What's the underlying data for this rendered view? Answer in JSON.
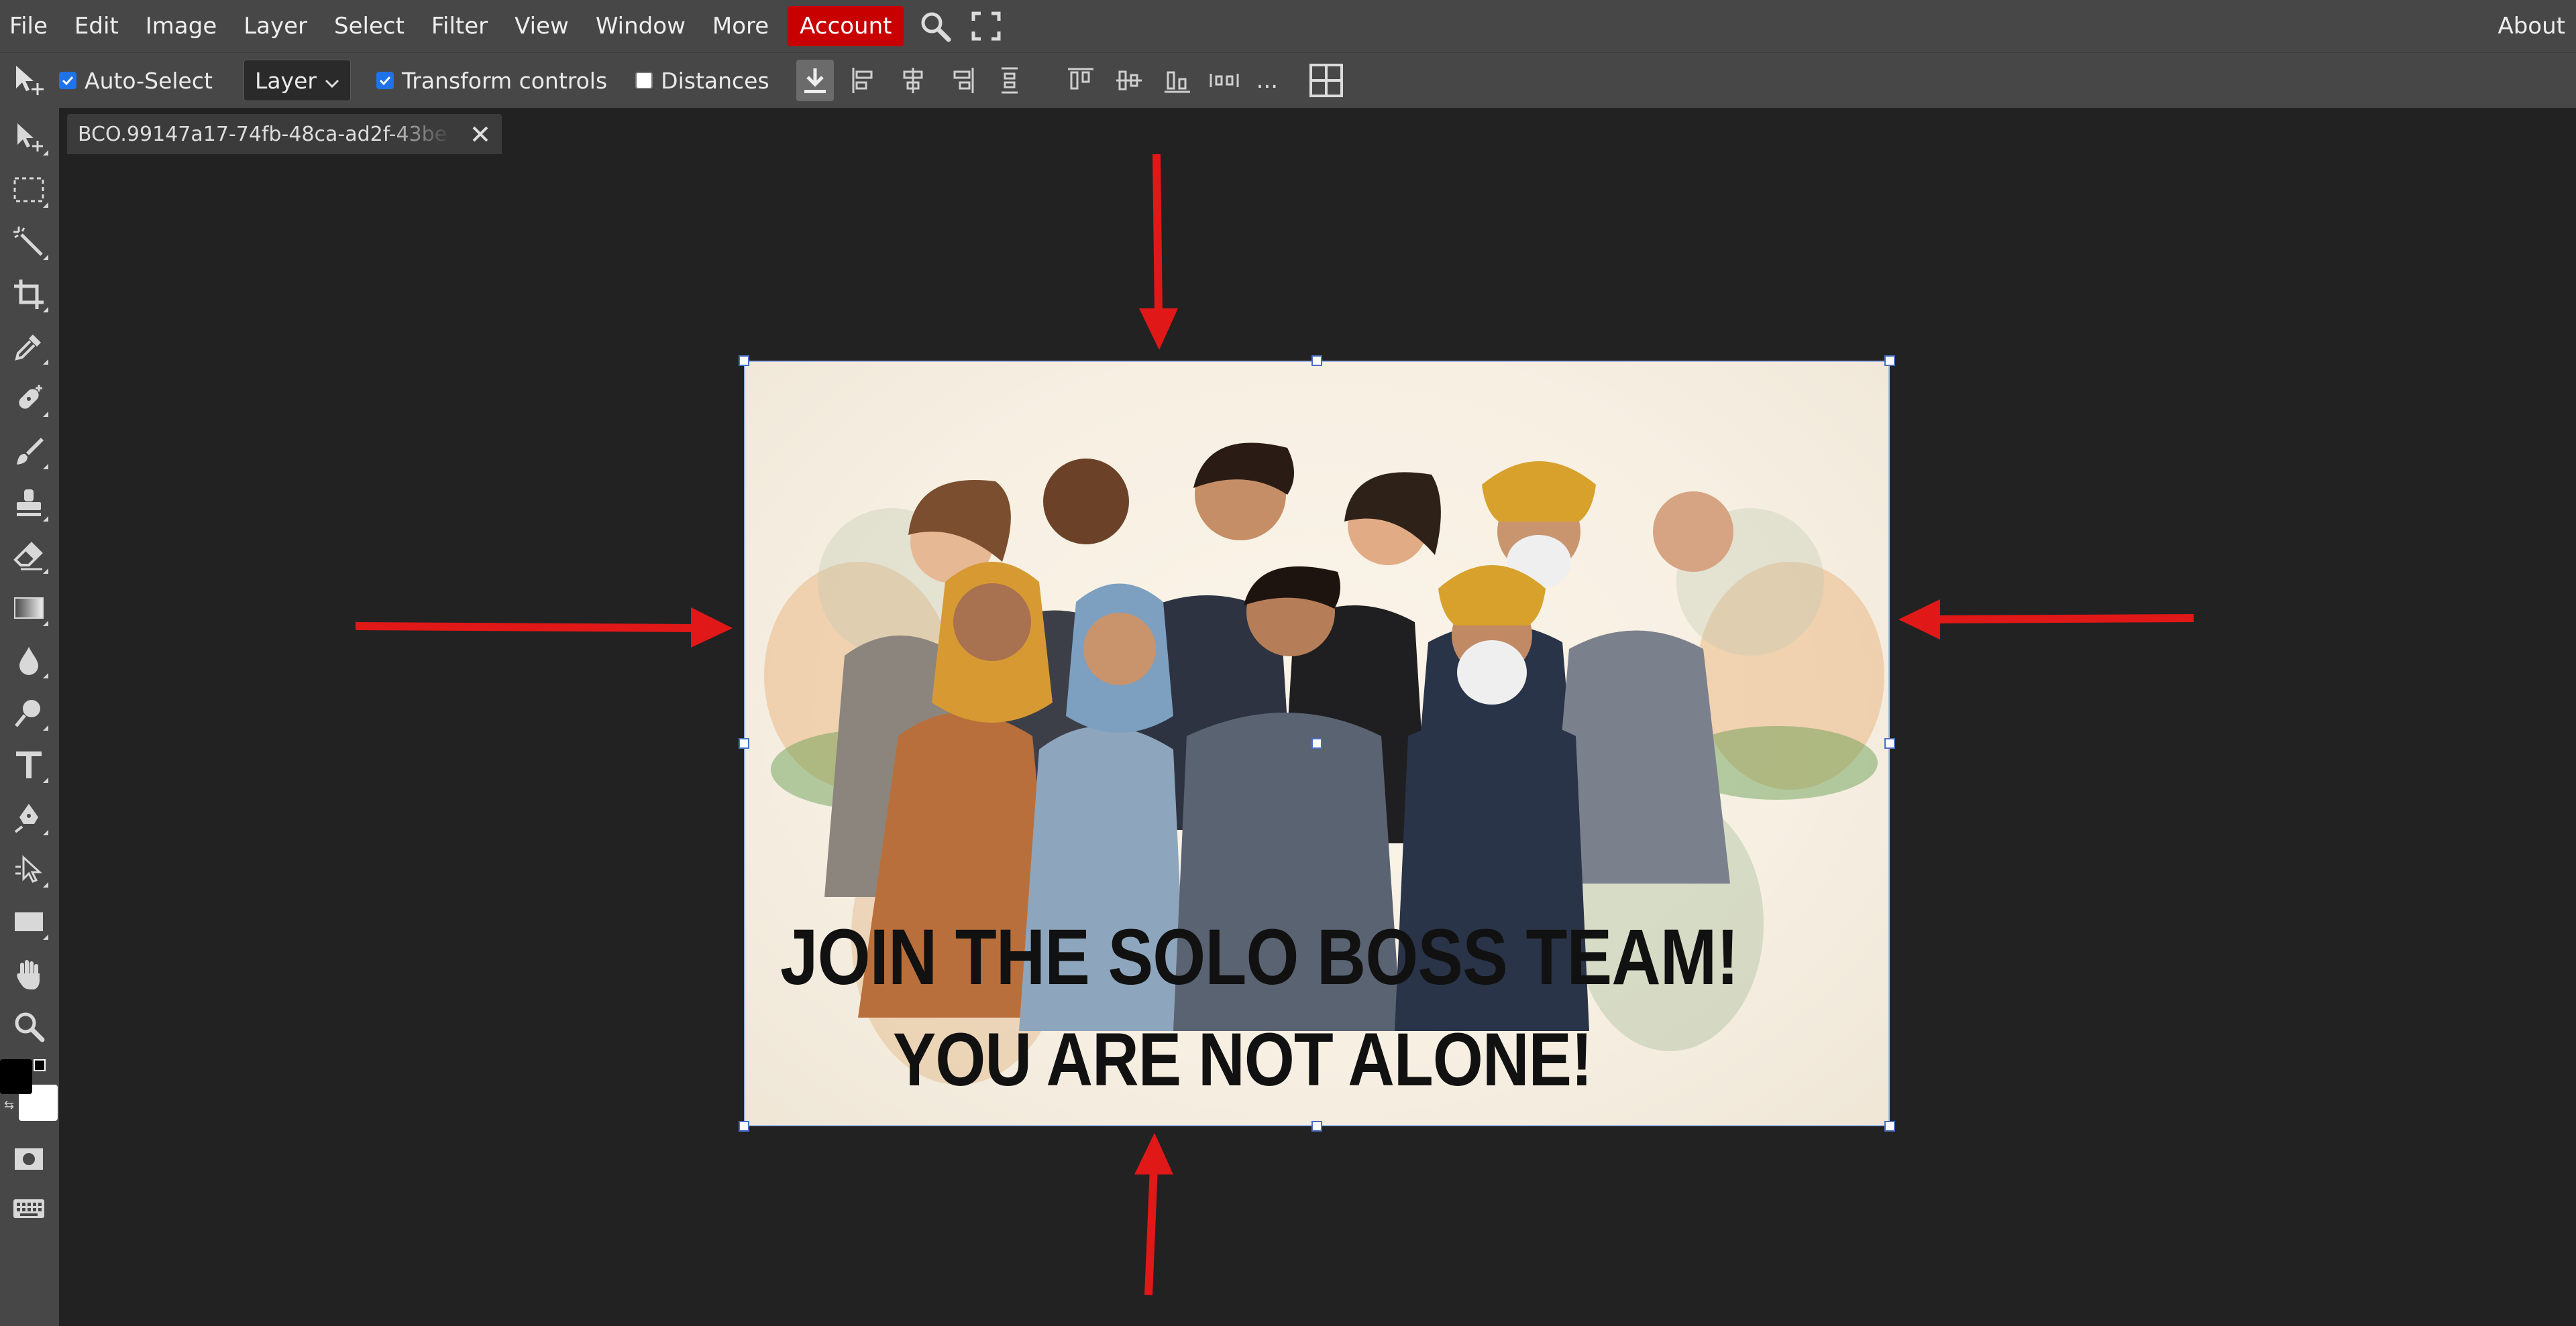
{
  "menu": {
    "items": [
      "File",
      "Edit",
      "Image",
      "Layer",
      "Select",
      "Filter",
      "View",
      "Window",
      "More"
    ],
    "account_label": "Account",
    "about_label": "About",
    "icons": [
      "search-icon",
      "fullscreen-icon"
    ]
  },
  "options": {
    "auto_select_label": "Auto-Select",
    "auto_select_checked": true,
    "layer_select_value": "Layer",
    "transform_controls_label": "Transform controls",
    "transform_controls_checked": true,
    "distances_label": "Distances",
    "distances_checked": false,
    "more_label": "..."
  },
  "document": {
    "tab_title": "BCO.99147a17-74fb-48ca-ad2f-43be",
    "close_icon": "close-icon"
  },
  "poster": {
    "line1": "JOIN THE SOLO BOSS TEAM!",
    "line2": "YOU ARE NOT ALONE!"
  },
  "colors": {
    "accent_account": "#c80000",
    "checkbox_blue": "#1e73e8",
    "arrow_red": "#e01818",
    "ui_panel": "#474747",
    "workspace": "#222222"
  }
}
